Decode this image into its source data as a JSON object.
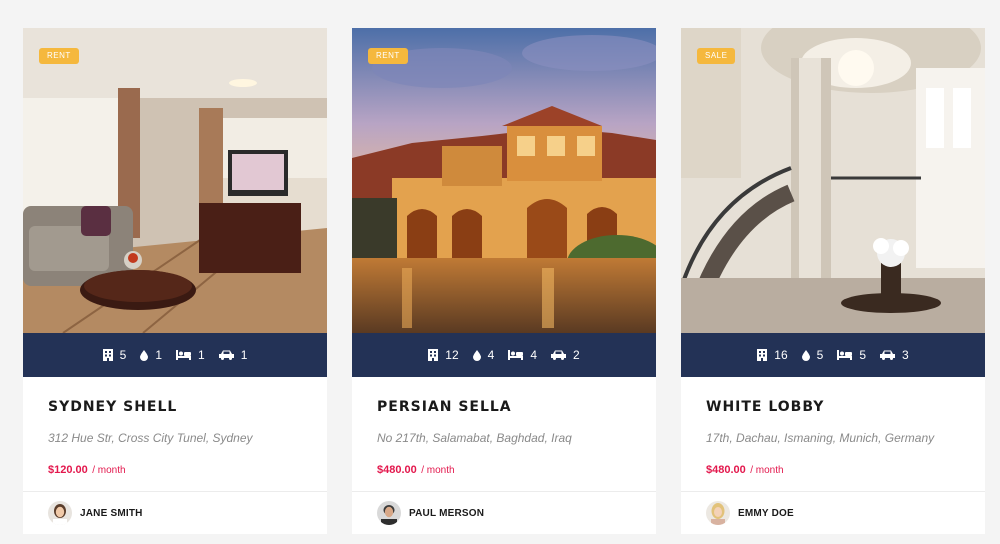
{
  "colors": {
    "badge": "#f5b83d",
    "stats_bar": "#233256",
    "price": "#e3184d"
  },
  "listings": [
    {
      "badge": "RENT",
      "photo": "hotel-room-interior",
      "stats": {
        "floors": "5",
        "baths": "1",
        "beds": "1",
        "garages": "1"
      },
      "title": "SYDNEY SHELL",
      "address": "312 Hue Str, Cross City Tunel, Sydney",
      "price": "$120.00",
      "period": "/ month",
      "agent": "JANE SMITH"
    },
    {
      "badge": "RENT",
      "photo": "mediterranean-villa-exterior",
      "stats": {
        "floors": "12",
        "baths": "4",
        "beds": "4",
        "garages": "2"
      },
      "title": "PERSIAN SELLA",
      "address": "No 217th, Salamabat, Baghdad, Iraq",
      "price": "$480.00",
      "period": "/ month",
      "agent": "PAUL MERSON"
    },
    {
      "badge": "SALE",
      "photo": "grand-lobby-staircase",
      "stats": {
        "floors": "16",
        "baths": "5",
        "beds": "5",
        "garages": "3"
      },
      "title": "WHITE LOBBY",
      "address": "17th, Dachau, Ismaning, Munich, Germany",
      "price": "$480.00",
      "period": "/ month",
      "agent": "EMMY DOE"
    }
  ]
}
